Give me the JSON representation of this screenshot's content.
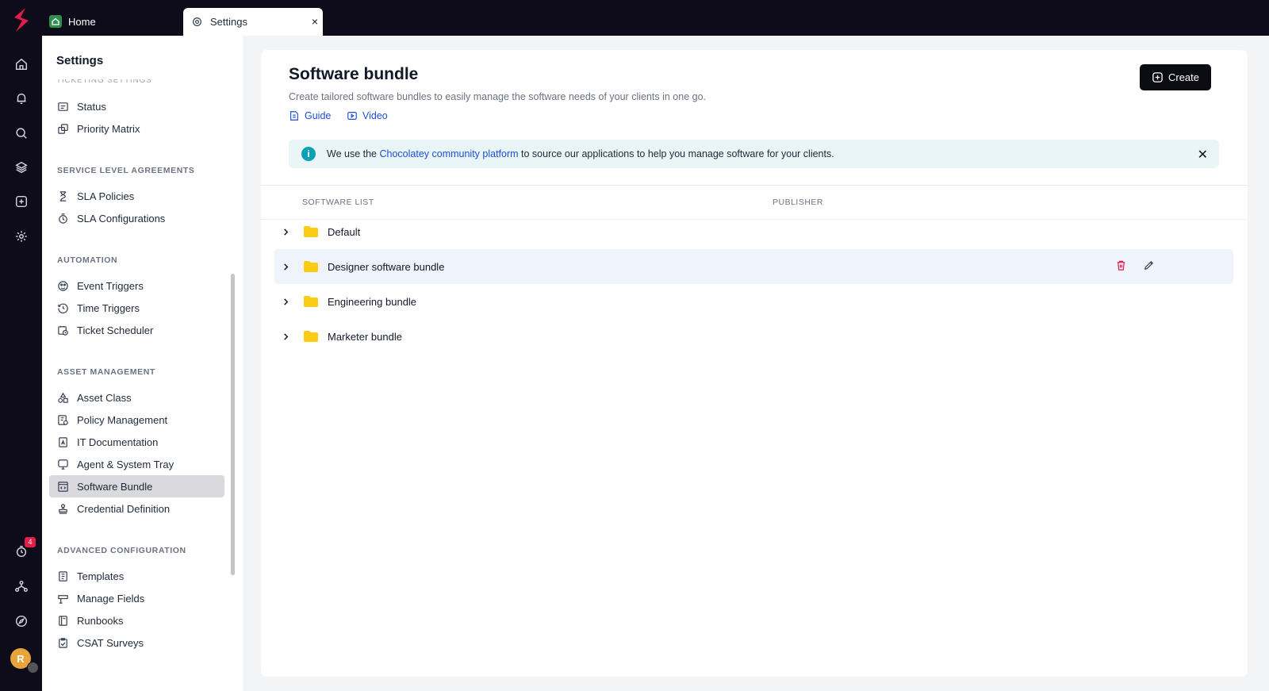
{
  "tabs": {
    "home_label": "Home",
    "settings_label": "Settings",
    "close_glyph": "×"
  },
  "rail": {
    "notification_count": "4",
    "avatar_initial": "R"
  },
  "nav": {
    "title": "Settings",
    "cut_heading": "TICKETING SETTINGS",
    "sections": [
      {
        "heading": "",
        "items": [
          {
            "label": "Status",
            "icon": "status-icon"
          },
          {
            "label": "Priority Matrix",
            "icon": "priority-matrix-icon"
          }
        ]
      },
      {
        "heading": "SERVICE LEVEL AGREEMENTS",
        "items": [
          {
            "label": "SLA Policies",
            "icon": "hourglass-icon"
          },
          {
            "label": "SLA Configurations",
            "icon": "stopwatch-icon"
          }
        ]
      },
      {
        "heading": "AUTOMATION",
        "items": [
          {
            "label": "Event Triggers",
            "icon": "event-trigger-icon"
          },
          {
            "label": "Time Triggers",
            "icon": "clock-icon"
          },
          {
            "label": "Ticket Scheduler",
            "icon": "calendar-clock-icon"
          }
        ]
      },
      {
        "heading": "ASSET MANAGEMENT",
        "items": [
          {
            "label": "Asset Class",
            "icon": "shapes-icon"
          },
          {
            "label": "Policy Management",
            "icon": "policy-icon"
          },
          {
            "label": "IT Documentation",
            "icon": "document-icon"
          },
          {
            "label": "Agent & System Tray",
            "icon": "monitor-icon"
          },
          {
            "label": "Software Bundle",
            "icon": "code-window-icon",
            "active": true
          },
          {
            "label": "Credential Definition",
            "icon": "stamp-icon"
          }
        ]
      },
      {
        "heading": "ADVANCED CONFIGURATION",
        "items": [
          {
            "label": "Templates",
            "icon": "template-icon"
          },
          {
            "label": "Manage Fields",
            "icon": "fields-icon"
          },
          {
            "label": "Runbooks",
            "icon": "book-icon"
          },
          {
            "label": "CSAT Surveys",
            "icon": "clipboard-check-icon"
          }
        ]
      }
    ]
  },
  "main": {
    "title": "Software bundle",
    "subtitle": "Create tailored software bundles to easily manage the software needs of your clients in one go.",
    "guide_label": "Guide",
    "video_label": "Video",
    "create_label": "Create",
    "banner": {
      "prefix": "We use the ",
      "link": "Chocolatey community platform",
      "suffix": " to source our applications to help you manage software for your clients."
    },
    "columns": [
      "SOFTWARE LIST",
      "PUBLISHER"
    ],
    "rows": [
      {
        "name": "Default"
      },
      {
        "name": "Designer software bundle",
        "hovered": true
      },
      {
        "name": "Engineering bundle"
      },
      {
        "name": "Marketer bundle"
      }
    ]
  },
  "colors": {
    "brand": "#e11d48",
    "dark": "#0e0c1a",
    "link": "#1d4ed8",
    "folder": "#facc15",
    "banner_bg": "#e9f5f7",
    "active_nav": "#d9d9de"
  }
}
